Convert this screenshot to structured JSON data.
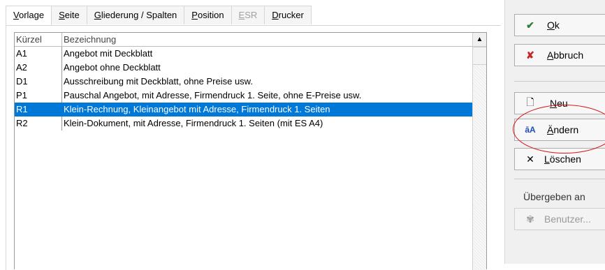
{
  "tabs": [
    {
      "label": "Vorlage",
      "accel": "V",
      "rest": "orlage"
    },
    {
      "label": "Seite",
      "accel": "S",
      "rest": "eite"
    },
    {
      "label": "Gliederung / Spalten",
      "accel": "G",
      "rest": "liederung / Spalten"
    },
    {
      "label": "Position",
      "accel": "P",
      "rest": "osition"
    },
    {
      "label": "ESR",
      "accel": "E",
      "rest": "SR"
    },
    {
      "label": "Drucker",
      "accel": "D",
      "rest": "rucker"
    }
  ],
  "list": {
    "headers": {
      "code": "Kürzel",
      "name": "Bezeichnung"
    },
    "rows": [
      {
        "code": "A1",
        "name": "Angebot mit Deckblatt"
      },
      {
        "code": "A2",
        "name": "Angebot ohne Deckblatt"
      },
      {
        "code": "D1",
        "name": "Ausschreibung mit Deckblatt, ohne Preise usw."
      },
      {
        "code": "P1",
        "name": "Pauschal Angebot, mit Adresse, Firmendruck 1. Seite, ohne E-Preise usw."
      },
      {
        "code": "R1",
        "name": "Klein-Rechnung, Kleinangebot mit Adresse, Firmendruck 1. Seiten"
      },
      {
        "code": "R2",
        "name": "Klein-Dokument, mit Adresse, Firmendruck 1. Seiten (mit ES A4)"
      }
    ],
    "selected_row": "R1"
  },
  "buttons": {
    "ok": {
      "accel": "O",
      "rest": "k",
      "icon": "check-icon"
    },
    "abbruch": {
      "accel": "A",
      "rest": "bbruch",
      "icon": "cross-icon"
    },
    "neu": {
      "accel": "N",
      "rest": "eu",
      "icon": "new-page-icon"
    },
    "aendern": {
      "accel": "Ä",
      "rest": "ndern",
      "icon": "edit-text-icon"
    },
    "loeschen": {
      "accel": "L",
      "rest": "öschen",
      "icon": "delete-icon"
    },
    "benutzer": {
      "label": "Benutzer...",
      "icon": "users-icon"
    }
  },
  "section_label": "Übergeben an",
  "colors": {
    "selection": "#0078d7",
    "highlight_circle": "#d6141c",
    "check": "#2e7d32",
    "cross": "#c62828"
  }
}
